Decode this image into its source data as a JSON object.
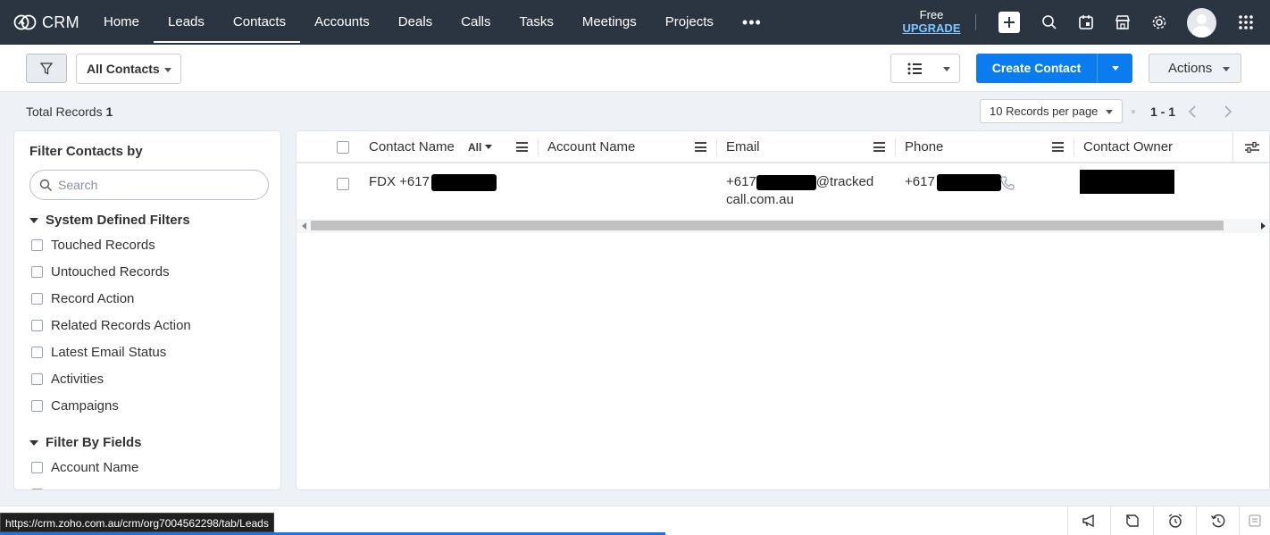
{
  "app": {
    "name": "CRM"
  },
  "nav": {
    "tabs": [
      {
        "label": "Home",
        "active": false
      },
      {
        "label": "Leads",
        "active": true
      },
      {
        "label": "Contacts",
        "active": true
      },
      {
        "label": "Accounts",
        "active": false
      },
      {
        "label": "Deals",
        "active": false
      },
      {
        "label": "Calls",
        "active": false
      },
      {
        "label": "Tasks",
        "active": false
      },
      {
        "label": "Meetings",
        "active": false
      },
      {
        "label": "Projects",
        "active": false
      },
      {
        "label": "•••",
        "active": false
      }
    ],
    "upgrade": {
      "plan": "Free",
      "link": "UPGRADE"
    },
    "icons": [
      "plus-icon",
      "search-icon",
      "calendar-icon",
      "marketplace-icon",
      "settings-icon",
      "avatar",
      "apps-grid-icon"
    ]
  },
  "toolbar": {
    "view": "All Contacts",
    "create_label": "Create Contact",
    "actions_label": "Actions"
  },
  "records": {
    "total_label": "Total Records",
    "total_count": "1",
    "per_page": "10 Records per page",
    "range": "1 - 1"
  },
  "sidebar": {
    "title": "Filter Contacts by",
    "search_placeholder": "Search",
    "system_title": "System Defined Filters",
    "system_filters": [
      "Touched Records",
      "Untouched Records",
      "Record Action",
      "Related Records Action",
      "Latest Email Status",
      "Activities",
      "Campaigns"
    ],
    "fields_title": "Filter By Fields",
    "field_filters": [
      "Account Name"
    ]
  },
  "table": {
    "columns": [
      "Contact Name",
      "Account Name",
      "Email",
      "Phone",
      "Contact Owner"
    ],
    "all_label": "All",
    "rows": [
      {
        "contact_name_prefix": "FDX +617",
        "account_name": "",
        "email_prefix": "+617",
        "email_suffix": "@tracked",
        "email_line2": "call.com.au",
        "phone_prefix": "+617"
      }
    ]
  },
  "status_url": "https://crm.zoho.com.au/crm/org7004562298/tab/Leads",
  "colors": {
    "nav_bg": "#2b3542",
    "primary": "#0a7cf0",
    "upgrade": "#7fc8ff"
  }
}
